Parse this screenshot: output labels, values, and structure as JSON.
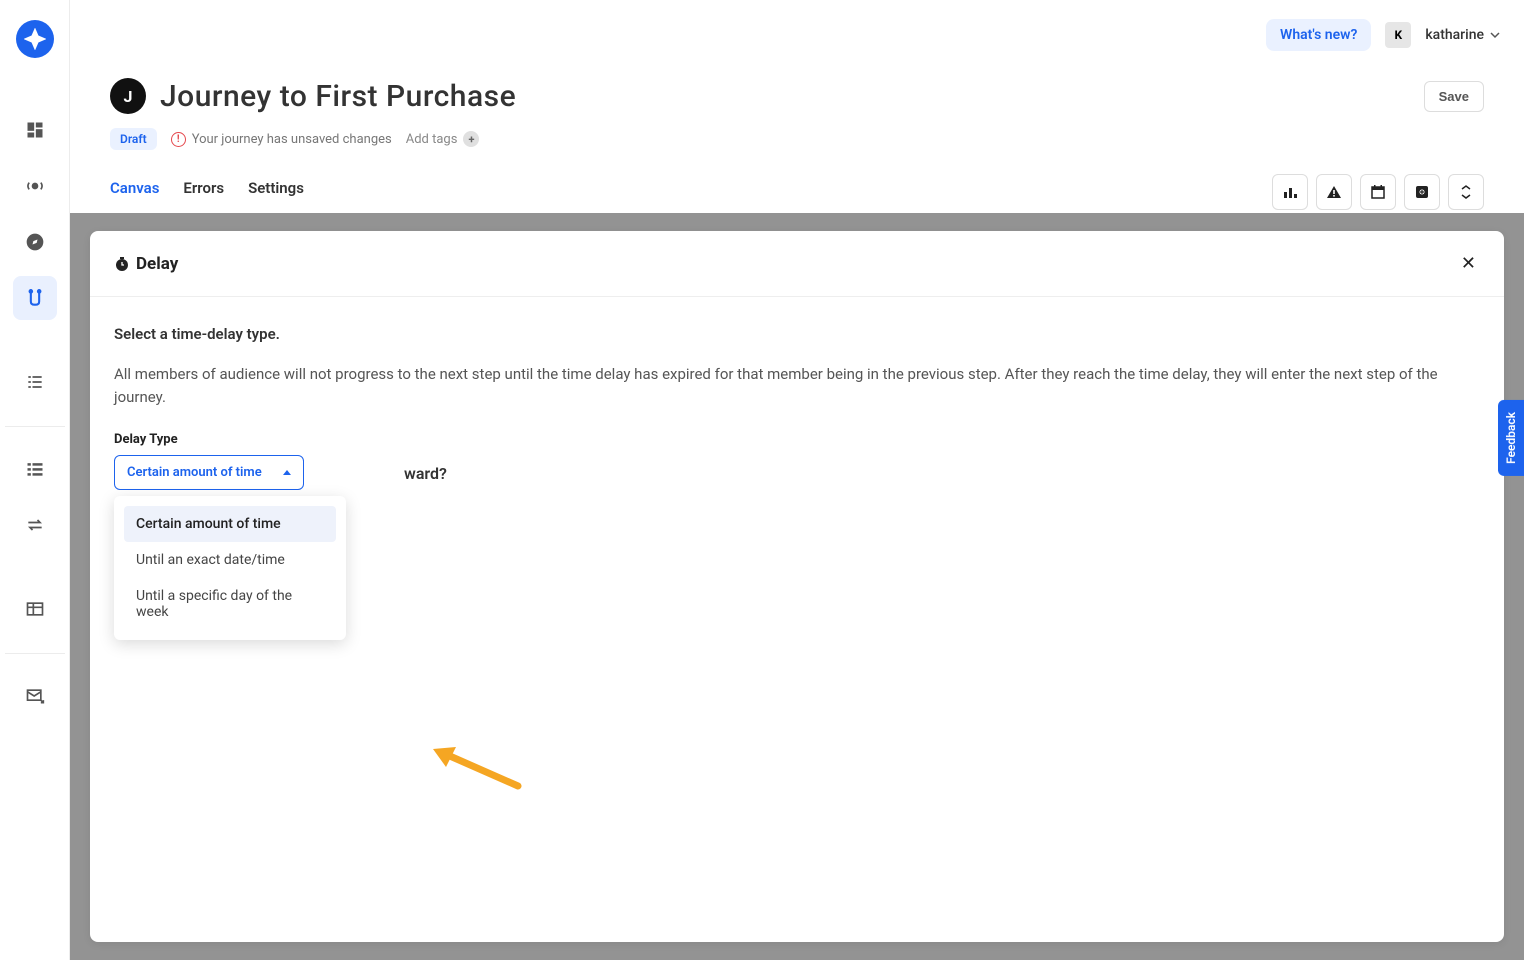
{
  "topbar": {
    "whats_new": "What's new?",
    "user_initial": "K",
    "user_name": "katharine"
  },
  "header": {
    "badge_letter": "J",
    "title": "Journey to First Purchase",
    "save_label": "Save",
    "draft_label": "Draft",
    "unsaved_text": "Your journey has unsaved changes",
    "add_tags_label": "Add tags"
  },
  "tabs": {
    "canvas": "Canvas",
    "errors": "Errors",
    "settings": "Settings"
  },
  "panel": {
    "title": "Delay",
    "prompt": "Select a time-delay type.",
    "description": "All members of audience will not progress to the next step until the time delay has expired for that member being in the previous step. After they reach the time delay, they will enter the next step of the journey.",
    "field_label": "Delay Type",
    "selected_value": "Certain amount of time",
    "behind_question_fragment": "ward?",
    "options": [
      "Certain amount of time",
      "Until an exact date/time",
      "Until a specific day of the week"
    ]
  },
  "feedback_label": "Feedback"
}
